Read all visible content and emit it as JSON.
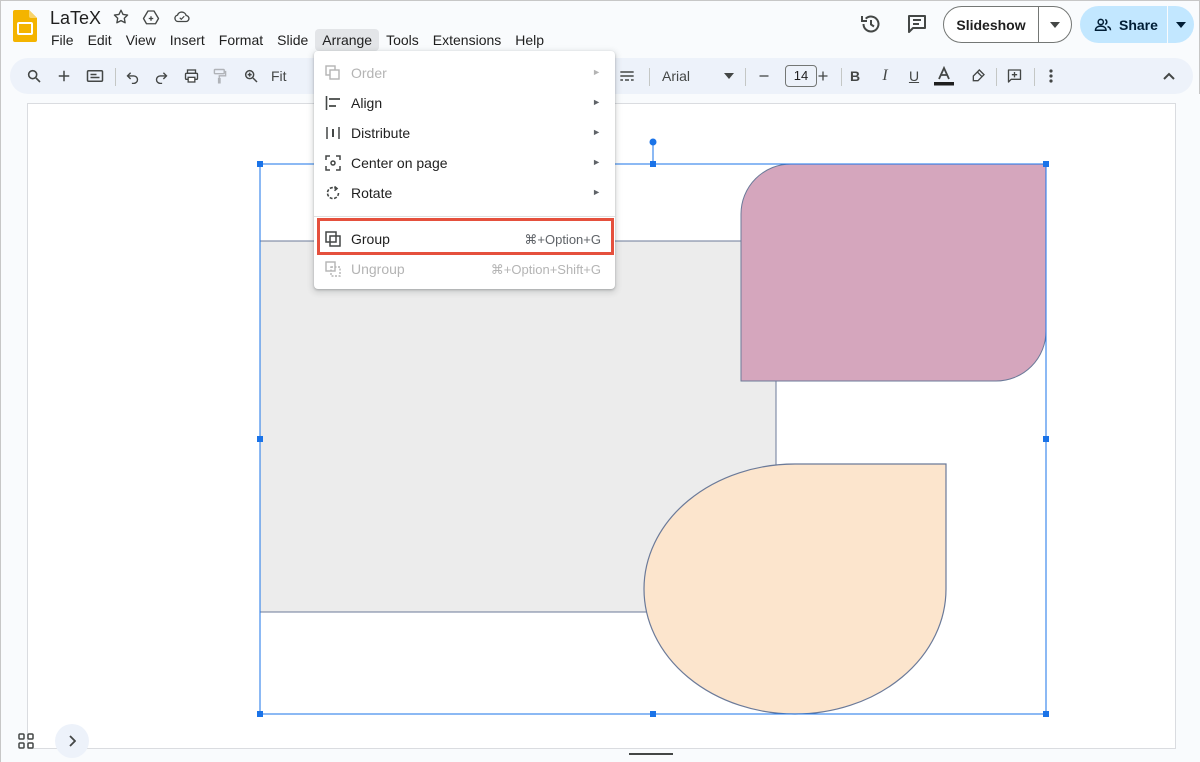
{
  "app": {
    "doc_title": "LaTeX",
    "menu": [
      "File",
      "Edit",
      "View",
      "Insert",
      "Format",
      "Slide",
      "Arrange",
      "Tools",
      "Extensions",
      "Help"
    ],
    "active_menu": "Arrange"
  },
  "header": {
    "slideshow_label": "Slideshow",
    "share_label": "Share"
  },
  "toolbar": {
    "zoom_label": "Fit",
    "font_name": "Arial",
    "font_size": "14"
  },
  "arrange_menu": {
    "items": [
      {
        "label": "Order",
        "icon": "order-icon",
        "submenu": true,
        "disabled": true
      },
      {
        "label": "Align",
        "icon": "align-icon",
        "submenu": true,
        "disabled": false
      },
      {
        "label": "Distribute",
        "icon": "distribute-icon",
        "submenu": true,
        "disabled": false
      },
      {
        "label": "Center on page",
        "icon": "center-icon",
        "submenu": true,
        "disabled": false
      },
      {
        "label": "Rotate",
        "icon": "rotate-icon",
        "submenu": true,
        "disabled": false
      }
    ],
    "group": {
      "label": "Group",
      "shortcut": "⌘+Option+G",
      "highlighted": true
    },
    "ungroup": {
      "label": "Ungroup",
      "shortcut": "⌘+Option+Shift+G",
      "disabled": true
    }
  },
  "colors": {
    "selection": "#1a73e8",
    "rect_fill": "#ececec",
    "pink_fill": "#d5a6bd",
    "peach_fill": "#fce5cd",
    "highlight": "#e5503d",
    "toolbar_bg": "#edf2fa",
    "share_bg": "#c2e7ff"
  }
}
